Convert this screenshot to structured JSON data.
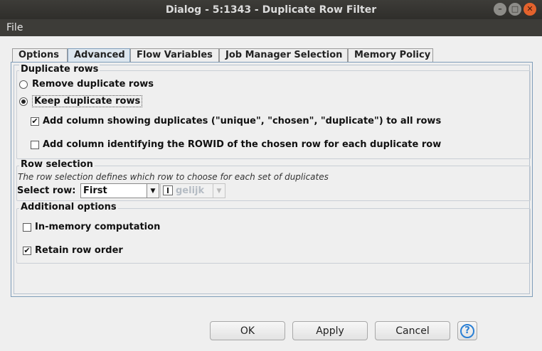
{
  "window": {
    "title": "Dialog - 5:1343 - Duplicate Row Filter"
  },
  "menu": {
    "file": "File"
  },
  "tabs": [
    {
      "label": "Options"
    },
    {
      "label": "Advanced"
    },
    {
      "label": "Flow Variables"
    },
    {
      "label": "Job Manager Selection"
    },
    {
      "label": "Memory Policy"
    }
  ],
  "active_tab": "Advanced",
  "duplicate_rows": {
    "legend": "Duplicate rows",
    "remove_label": "Remove duplicate rows",
    "keep_label": "Keep duplicate rows",
    "add_column_label": "Add column showing duplicates (\"unique\", \"chosen\", \"duplicate\") to all rows",
    "add_rowid_label": "Add column identifying the ROWID of the chosen row for each duplicate row",
    "selected": "keep",
    "add_column_checked": true,
    "add_rowid_checked": false
  },
  "row_selection": {
    "legend": "Row selection",
    "description": "The row selection defines which row to choose for each set of duplicates",
    "select_label": "Select row:",
    "select_value": "First",
    "column_value": "gelijk"
  },
  "additional": {
    "legend": "Additional options",
    "in_memory_label": "In-memory computation",
    "retain_label": "Retain row order",
    "in_memory_checked": false,
    "retain_checked": true
  },
  "buttons": {
    "ok": "OK",
    "apply": "Apply",
    "cancel": "Cancel",
    "help": "?"
  }
}
